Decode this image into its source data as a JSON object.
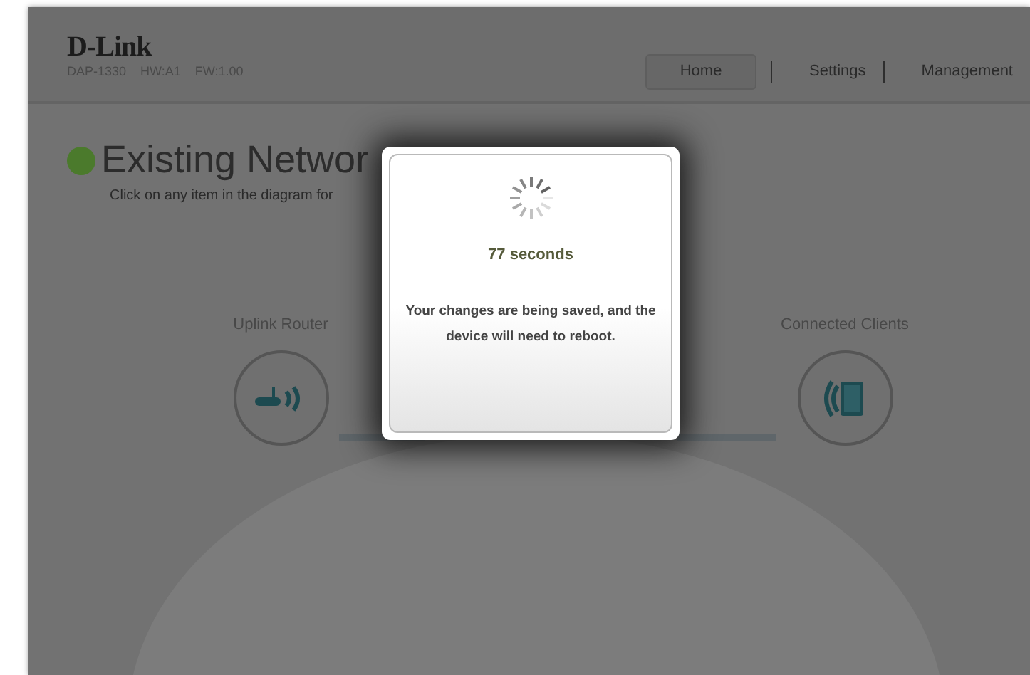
{
  "header": {
    "logo": "D-Link",
    "device_info": [
      "DAP-1330",
      "HW:A1",
      "FW:1.00"
    ],
    "nav": [
      {
        "label": "Home",
        "selected": true
      },
      {
        "label": "Settings",
        "selected": false
      },
      {
        "label": "Management",
        "selected": false
      }
    ]
  },
  "page": {
    "title": "Existing Networ",
    "subtitle": "Click on any item in the diagram for"
  },
  "diagram": {
    "nodes": [
      {
        "label": "Uplink Router",
        "kind": "router"
      },
      {
        "label": "Connected Clients",
        "kind": "clients"
      }
    ]
  },
  "dialog": {
    "countdown": "77 seconds",
    "message": "Your changes are being saved, and the device will need to reboot."
  }
}
